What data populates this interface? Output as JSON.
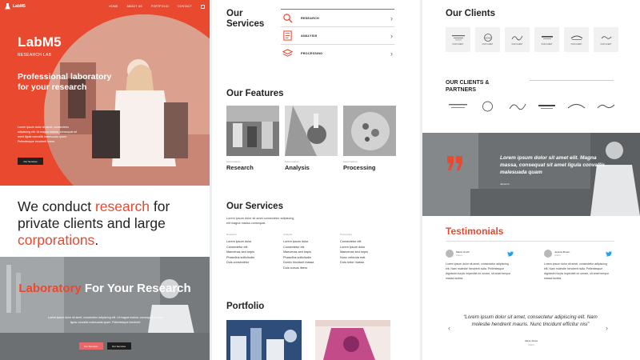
{
  "colors": {
    "accent": "#e8492f",
    "dark": "#222222",
    "muted": "#888888"
  },
  "hero": {
    "brand": "LabM5",
    "nav": [
      "HOME",
      "ABOUT US",
      "PORTFOLIO",
      "CONTACT"
    ],
    "title": "LabM5",
    "subtitle": "RESEARCH LAB",
    "headline": "Professional laboratory for your research",
    "text": "Lorem ipsum dolor sit amet, consectetur adipiscing elit. Ut magna massa, consequat sit amet ligula convallis malesuada quam. Pellentesque hendrerit lorem.",
    "button": "Our Services"
  },
  "conduct": {
    "p1": "We conduct ",
    "h1": "research",
    "p2": " for private clients and large ",
    "h2": "corporations",
    "p3": "."
  },
  "lab": {
    "title_accent": "Laboratory",
    "title_rest": " For Your Research",
    "text": "Lorem ipsum dolor sit amet, consectetur adipiscing elit. Ut magna massa, consequat sit amet ligula convallis malesuada quam. Pellentesque hendrerit.",
    "button_primary": "Our Services",
    "button_dark": "Our Services"
  },
  "services": {
    "title": "Our Services",
    "items": [
      {
        "label": "RESEARCH",
        "icon": "magnifier-icon"
      },
      {
        "label": "ANALYSIS",
        "icon": "document-list-icon"
      },
      {
        "label": "PROCESSING",
        "icon": "layers-icon"
      }
    ]
  },
  "features": {
    "title": "Our Features",
    "items": [
      {
        "small": "Lorem ipsum",
        "label": "Research"
      },
      {
        "small": "Lorem ipsum",
        "label": "Analysis"
      },
      {
        "small": "Lorem ipsum",
        "label": "Processing"
      }
    ]
  },
  "services2": {
    "title": "Our Services",
    "text": "Lorem ipsum dolor sit amet consectetur adipiscing elit magna massa consequat.",
    "columns": [
      {
        "title": "Research",
        "items": [
          "Lorem ipsum dolor",
          "Consectetur elit",
          "Maecenas sed turpis",
          "Phasellus sollicitudin",
          "Duis consectetur"
        ]
      },
      {
        "title": "Analysis",
        "items": [
          "Lorem ipsum dolor",
          "Consectetur elit",
          "Maecenas sed turpis",
          "Phasellus sollicitudin",
          "Donec tincidunt massa",
          "Duis cursus libero"
        ]
      },
      {
        "title": "Processing",
        "items": [
          "Consectetur elit",
          "Lorem ipsum dolor",
          "Maecenas sed turpis",
          "Nunc vehicula erat",
          "Duis tortor massa"
        ]
      }
    ]
  },
  "portfolio": {
    "title": "Portfolio"
  },
  "clients": {
    "title": "Our Clients",
    "logo_caption": "OUR CLIENT",
    "logo_marks": [
      "PLANTAIN TEMPLE",
      "GENE",
      "Signature",
      "BIOMEDICAL",
      "Deluxe",
      "Chelsea"
    ],
    "partners_title": "OUR CLIENTS & PARTNERS"
  },
  "quote": {
    "text": "Lorem ipsum dolor sit amet elit. Magna massa, consequat sit amet ligula convallis malesuada quam",
    "author": "James F."
  },
  "testimonials": {
    "title": "Testimonials",
    "cards": [
      {
        "name": "Martin Smith",
        "role": "Client",
        "text": "Lorem ipsum dolor sit amet, consectetur adipiscing elit. Nam molestie hendrerit nulla. Pellentesque dignissim turpis imperdiet ex ornare, sit amet tempor massa lacinia."
      },
      {
        "name": "Jessica Brown",
        "role": "Client",
        "text": "Lorem ipsum dolor sit amet, consectetur adipiscing elit. Nam molestie hendrerit nulla. Pellentesque dignissim turpis imperdiet ex ornare, sit amet tempor massa lacinia."
      }
    ],
    "quote": "“Lorem ipsum dolor sit amet, consectetur adipiscing elit. Nam molestie hendrerit mauris. Nunc tincidunt efficitur nisi”",
    "quote_author": "Alexa Jones",
    "quote_role": "Client",
    "prev": "‹",
    "next": "›"
  }
}
